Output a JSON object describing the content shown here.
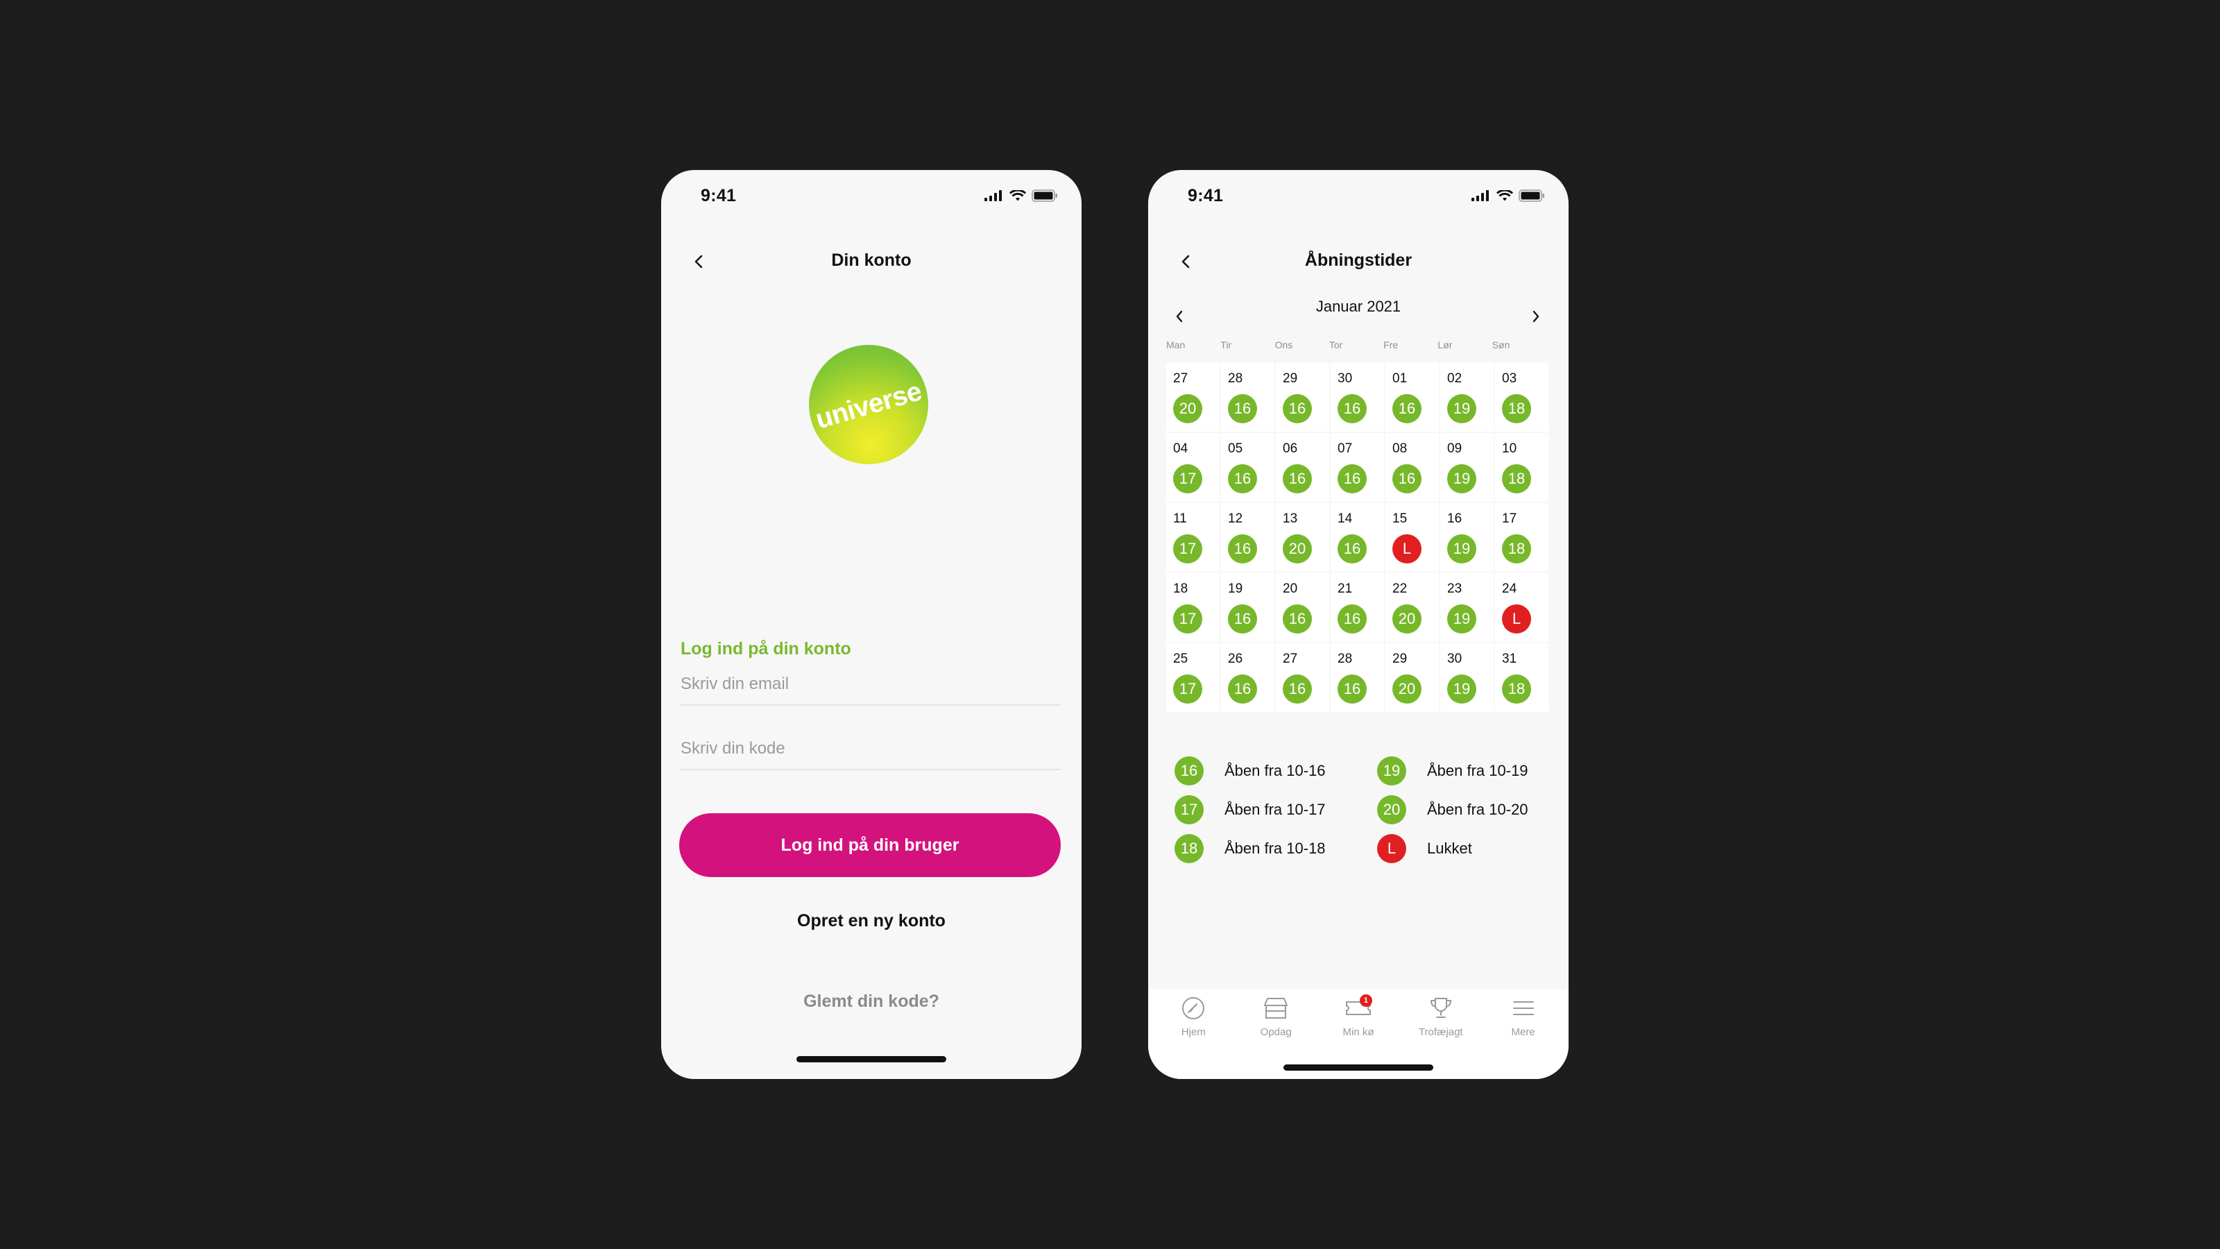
{
  "login_screen": {
    "status_time": "9:41",
    "title": "Din konto",
    "logo_text": "universe",
    "login_heading": "Log ind på din konto",
    "email_placeholder": "Skriv din email",
    "password_placeholder": "Skriv din kode",
    "login_button": "Log ind på din bruger",
    "create_account": "Opret en ny konto",
    "forgot_password": "Glemt din kode?"
  },
  "hours_screen": {
    "status_time": "9:41",
    "title": "Åbningstider",
    "month_label": "Januar 2021",
    "weekdays": [
      "Man",
      "Tir",
      "Ons",
      "Tor",
      "Fre",
      "Lør",
      "Søn"
    ],
    "weeks": [
      [
        {
          "day": "27",
          "code": "20"
        },
        {
          "day": "28",
          "code": "16"
        },
        {
          "day": "29",
          "code": "16"
        },
        {
          "day": "30",
          "code": "16"
        },
        {
          "day": "01",
          "code": "16"
        },
        {
          "day": "02",
          "code": "19"
        },
        {
          "day": "03",
          "code": "18"
        }
      ],
      [
        {
          "day": "04",
          "code": "17"
        },
        {
          "day": "05",
          "code": "16"
        },
        {
          "day": "06",
          "code": "16"
        },
        {
          "day": "07",
          "code": "16"
        },
        {
          "day": "08",
          "code": "16"
        },
        {
          "day": "09",
          "code": "19"
        },
        {
          "day": "10",
          "code": "18"
        }
      ],
      [
        {
          "day": "11",
          "code": "17"
        },
        {
          "day": "12",
          "code": "16"
        },
        {
          "day": "13",
          "code": "20"
        },
        {
          "day": "14",
          "code": "16"
        },
        {
          "day": "15",
          "code": "L"
        },
        {
          "day": "16",
          "code": "19"
        },
        {
          "day": "17",
          "code": "18"
        }
      ],
      [
        {
          "day": "18",
          "code": "17"
        },
        {
          "day": "19",
          "code": "16"
        },
        {
          "day": "20",
          "code": "16"
        },
        {
          "day": "21",
          "code": "16"
        },
        {
          "day": "22",
          "code": "20"
        },
        {
          "day": "23",
          "code": "19"
        },
        {
          "day": "24",
          "code": "L"
        }
      ],
      [
        {
          "day": "25",
          "code": "17"
        },
        {
          "day": "26",
          "code": "16"
        },
        {
          "day": "27",
          "code": "16"
        },
        {
          "day": "28",
          "code": "16"
        },
        {
          "day": "29",
          "code": "20"
        },
        {
          "day": "30",
          "code": "19"
        },
        {
          "day": "31",
          "code": "18"
        }
      ]
    ],
    "legend": [
      {
        "code": "16",
        "label": "Åben fra 10-16"
      },
      {
        "code": "19",
        "label": "Åben fra 10-19"
      },
      {
        "code": "17",
        "label": "Åben fra 10-17"
      },
      {
        "code": "20",
        "label": "Åben fra 10-20"
      },
      {
        "code": "18",
        "label": "Åben fra 10-18"
      },
      {
        "code": "L",
        "label": "Lukket"
      }
    ],
    "tabs": [
      {
        "name": "home",
        "label": "Hjem",
        "icon": "compass-icon"
      },
      {
        "name": "discover",
        "label": "Opdag",
        "icon": "store-icon"
      },
      {
        "name": "queue",
        "label": "Min kø",
        "icon": "ticket-icon",
        "badge": "1"
      },
      {
        "name": "trophy",
        "label": "Trofæjagt",
        "icon": "trophy-icon"
      },
      {
        "name": "more",
        "label": "Mere",
        "icon": "menu-icon"
      }
    ]
  },
  "colors": {
    "background": "#1d1d1d",
    "screen": "#f7f7f7",
    "brand_green": "#76b82a",
    "heading_green": "#7ab82e",
    "primary_magenta": "#d4127d",
    "closed_red": "#e02020",
    "muted_text": "#8a8a8a"
  }
}
